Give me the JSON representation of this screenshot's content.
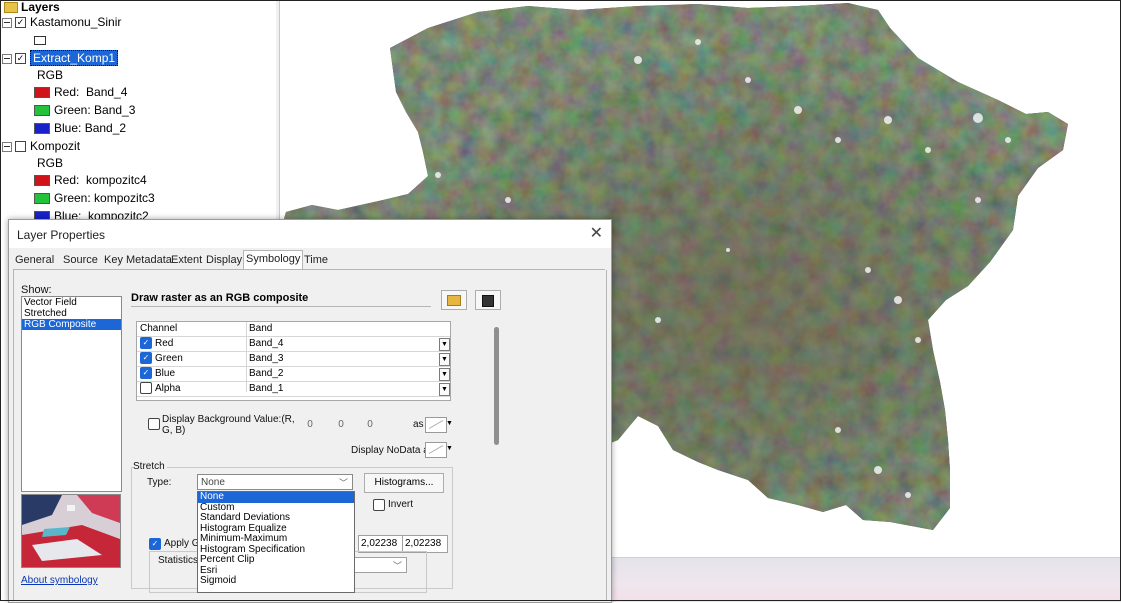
{
  "toc": {
    "title": "Layers",
    "layers": [
      {
        "name": "Kastamonu_Sinir",
        "checked": true
      },
      {
        "name": "Extract_Komp1",
        "checked": true,
        "mode": "RGB",
        "bands": [
          {
            "label": "Red:",
            "value": "Band_4",
            "color": "#d0121b"
          },
          {
            "label": "Green:",
            "value": "Band_3",
            "color": "#22c33b"
          },
          {
            "label": "Blue:",
            "value": "Band_2",
            "color": "#1922c8"
          }
        ]
      },
      {
        "name": "Kompozit",
        "checked": false,
        "mode": "RGB",
        "bands": [
          {
            "label": "Red:",
            "value": "kompozitc4",
            "color": "#d0121b"
          },
          {
            "label": "Green:",
            "value": "kompozitc3",
            "color": "#22c33b"
          },
          {
            "label": "Blue:",
            "value": "kompozitc2",
            "color": "#1922c8"
          }
        ]
      }
    ]
  },
  "dialog": {
    "title": "Layer Properties",
    "close_glyph": "✕",
    "tabs": [
      "General",
      "Source",
      "Key Metadata",
      "Extent",
      "Display",
      "Symbology",
      "Time"
    ],
    "active_tab": "Symbology",
    "show_label": "Show:",
    "show_items": [
      "Vector Field",
      "Stretched",
      "RGB Composite"
    ],
    "show_selected": "RGB Composite",
    "about_link": "About symbology",
    "heading": "Draw raster as an RGB composite",
    "band_table": {
      "col_channel": "Channel",
      "col_band": "Band",
      "rows": [
        {
          "channel": "Red",
          "band": "Band_4",
          "checked": true
        },
        {
          "channel": "Green",
          "band": "Band_3",
          "checked": true
        },
        {
          "channel": "Blue",
          "band": "Band_2",
          "checked": true
        },
        {
          "channel": "Alpha",
          "band": "Band_1",
          "checked": false
        }
      ]
    },
    "background": {
      "label_line1": "Display Background Value:(R,",
      "label_line2": "G, B)",
      "values": [
        "0",
        "0",
        "0"
      ],
      "as_label": "as",
      "nodata_label": "Display NoData as"
    },
    "stretch": {
      "group_label": "Stretch",
      "type_label": "Type:",
      "type_value": "None",
      "options": [
        "None",
        "Custom",
        "Standard Deviations",
        "Histogram Equalize",
        "Minimum-Maximum",
        "Histogram Specification",
        "Percent Clip",
        "Esri",
        "Sigmoid"
      ],
      "histograms_button": "Histograms...",
      "invert_label": "Invert",
      "apply_gamma_label": "Apply Ga",
      "gamma_values": [
        "2,02238",
        "2,02238"
      ],
      "statistics_label": "Statistics"
    }
  },
  "colors": {
    "selection_blue": "#1c66d6",
    "link_blue": "#0a36b5",
    "dialog_bg": "#f0f0f0"
  }
}
